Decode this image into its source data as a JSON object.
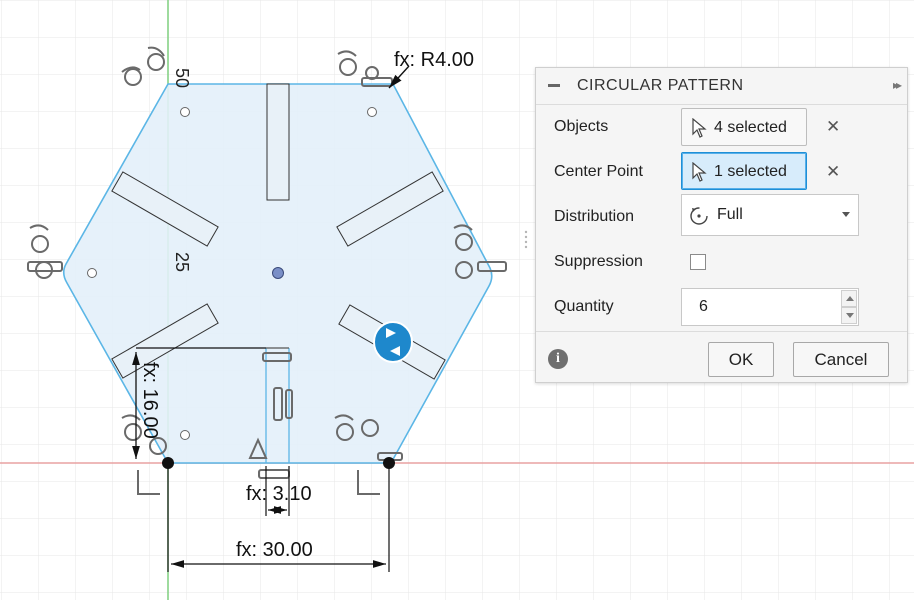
{
  "canvas": {
    "dimensions": {
      "radius": "fx: R4.00",
      "vertical_height": "fx: 16.00",
      "slot_width": "fx: 3.10",
      "overall_width": "fx: 30.00",
      "label_top": "50",
      "label_mid": "25"
    }
  },
  "panel": {
    "title": "CIRCULAR PATTERN",
    "expand_glyph": "▸▸",
    "rows": {
      "objects": {
        "label": "Objects",
        "value": "4 selected"
      },
      "center_point": {
        "label": "Center Point",
        "value": "1 selected"
      },
      "distribution": {
        "label": "Distribution",
        "value": "Full"
      },
      "suppression": {
        "label": "Suppression",
        "checked": false
      },
      "quantity": {
        "label": "Quantity",
        "value": "6"
      }
    },
    "clear_glyph": "✕",
    "info_glyph": "i",
    "ok_label": "OK",
    "cancel_label": "Cancel"
  },
  "icons": {
    "select-cursor": "cursor-arrow-icon",
    "distribution": "full-circle-distribution-icon",
    "info": "info-icon",
    "orbit-marker": "pattern-direction-icon"
  },
  "colors": {
    "sketch_line": "#5bb6e6",
    "sketch_fill": "#e3f0fa",
    "grid": "#e6e6e6",
    "x_axis": "#e8a6a6",
    "y_axis": "#8fd08f",
    "selection_accent": "#1f8fd6"
  }
}
